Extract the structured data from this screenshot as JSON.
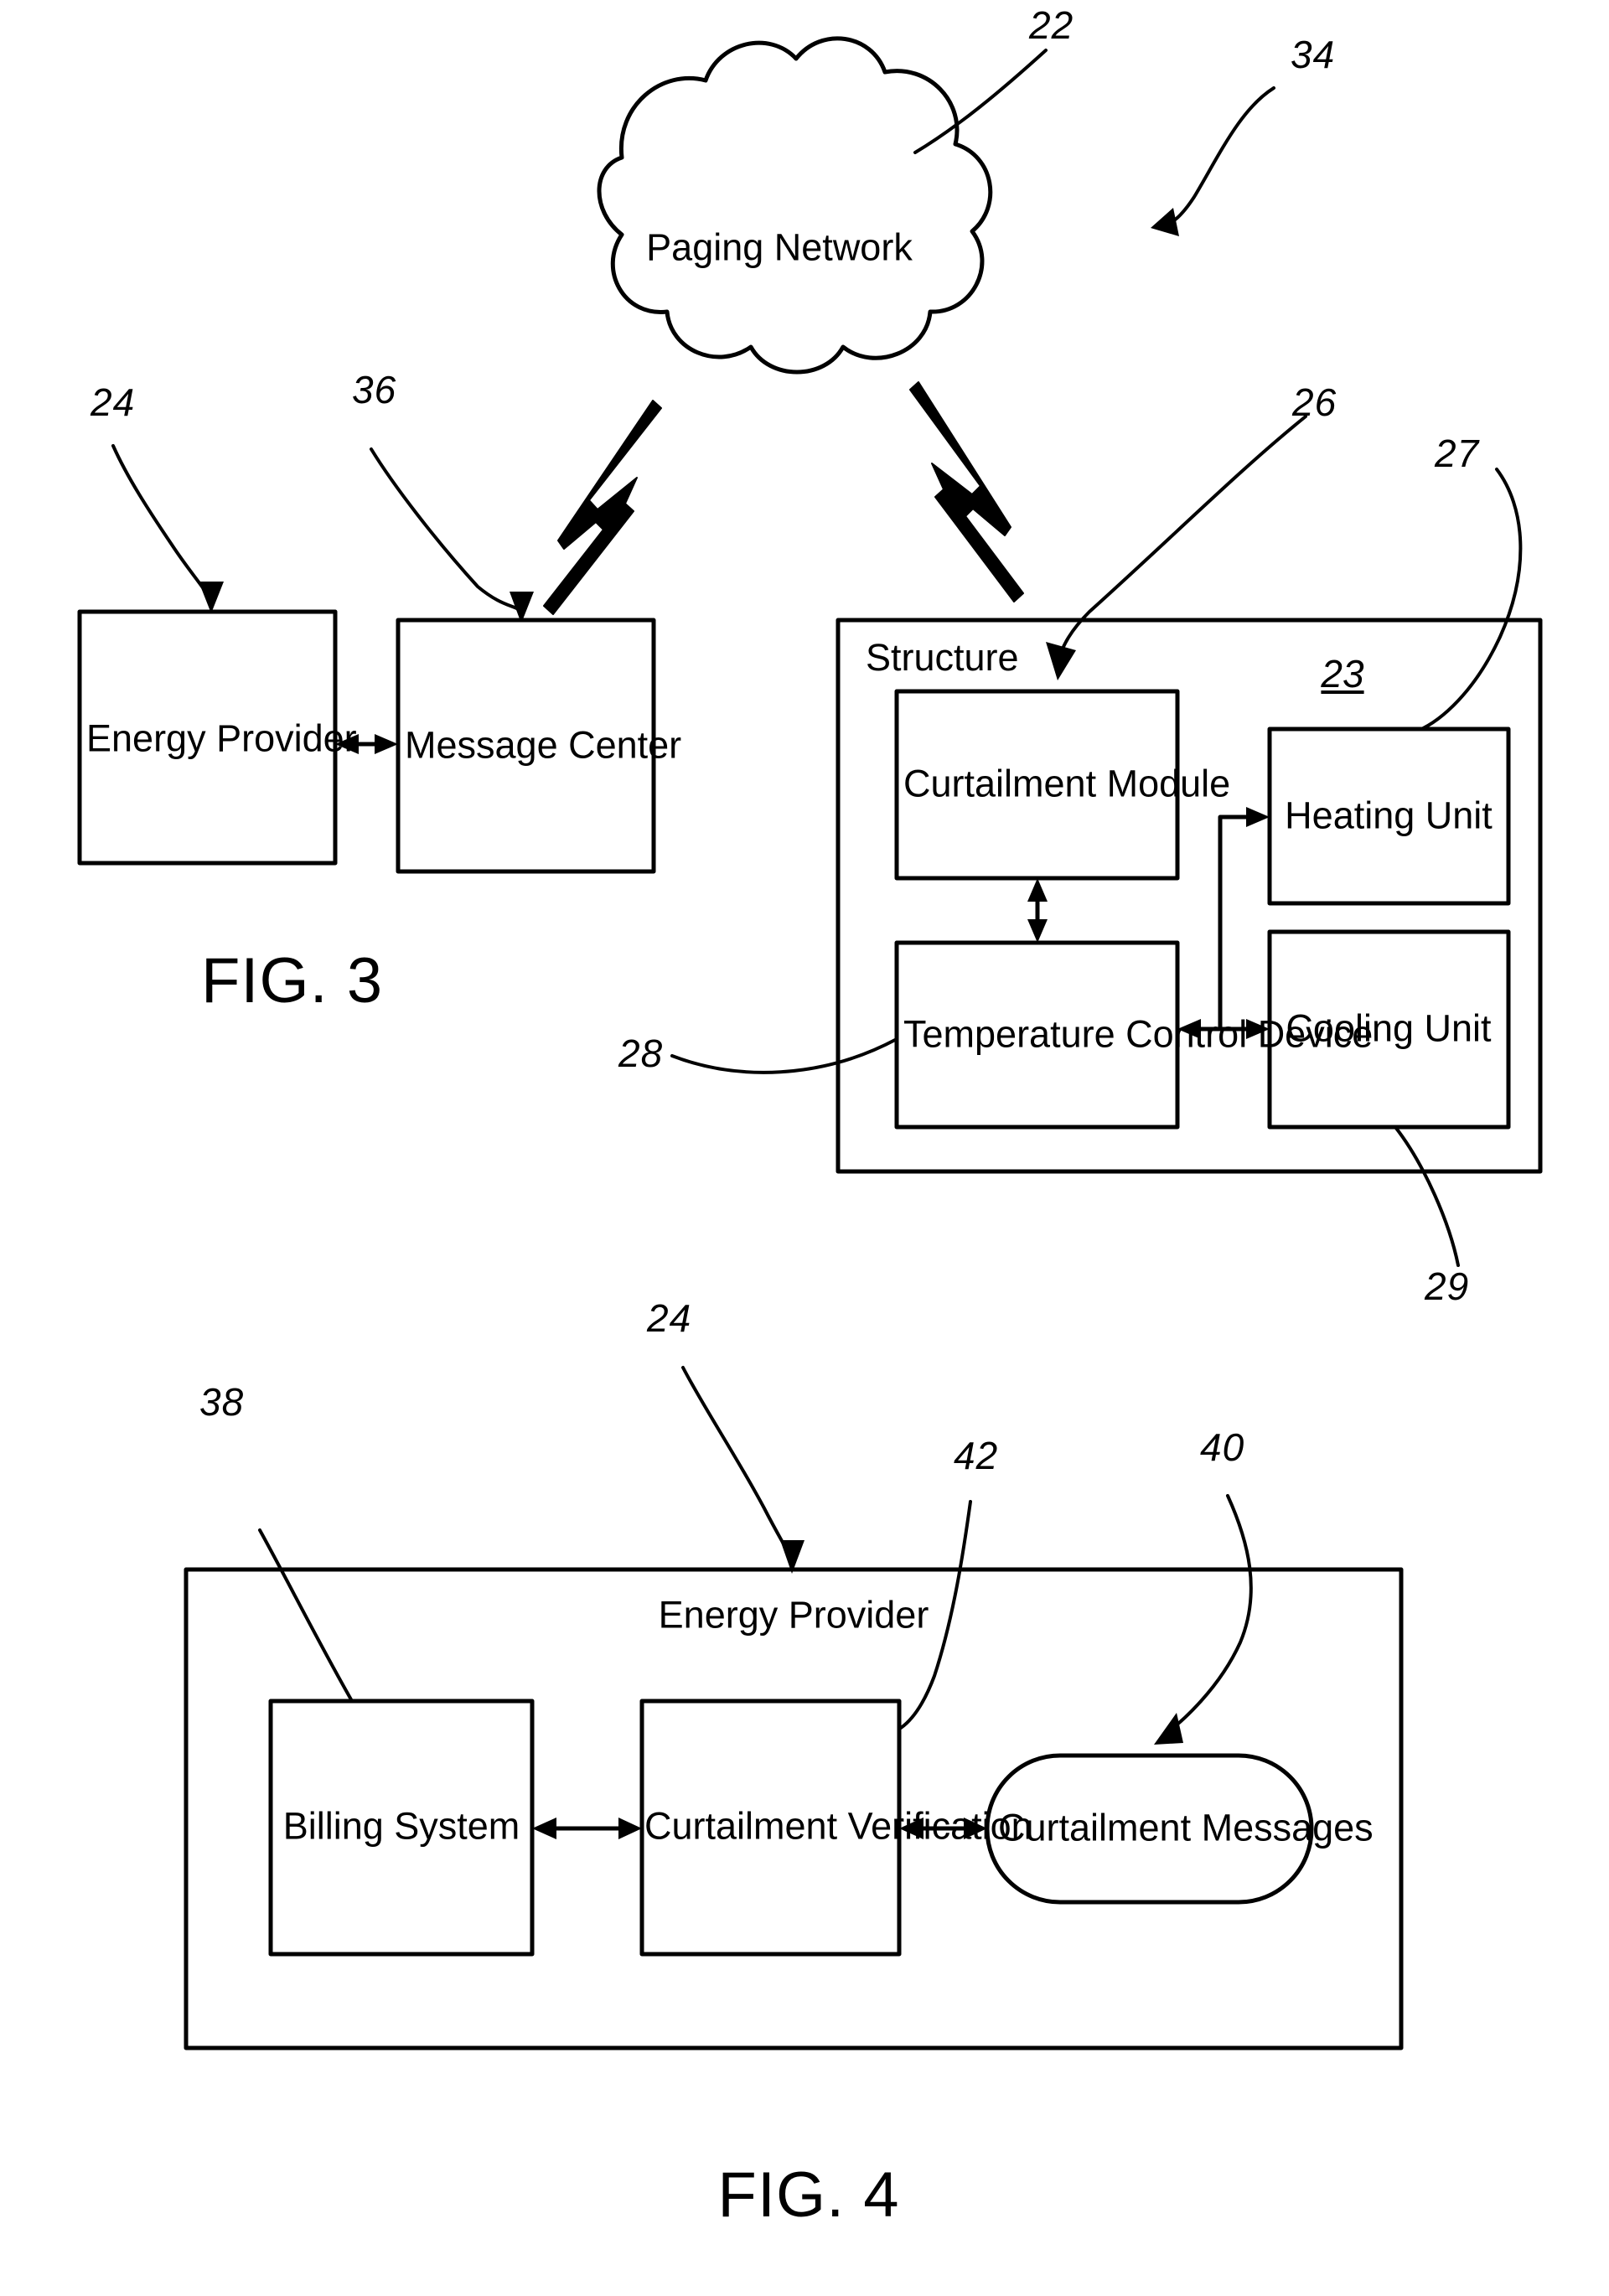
{
  "figures": [
    {
      "caption": "FIG. 3",
      "nodes": {
        "paging_network": "Paging Network",
        "energy_provider": "Energy Provider",
        "message_center": "Message Center",
        "structure": "Structure",
        "curtailment_module": "Curtailment Module",
        "temperature_control_device": "Temperature Control Device",
        "heating_unit": "Heating Unit",
        "cooling_unit": "Cooling Unit"
      },
      "refs": {
        "paging_network": "22",
        "system": "34",
        "energy_provider": "24",
        "message_center": "36",
        "curtailment_module": "26",
        "heating_unit": "27",
        "hvac_group": "23",
        "temperature_control_device": "28",
        "cooling_unit": "29"
      }
    },
    {
      "caption": "FIG. 4",
      "nodes": {
        "energy_provider": "Energy Provider",
        "billing_system": "Billing System",
        "curtailment_verification": "Curtailment Verification",
        "curtailment_messages": "Curtailment Messages"
      },
      "refs": {
        "billing_system": "38",
        "energy_provider": "24",
        "curtailment_verification": "42",
        "curtailment_messages": "40"
      }
    }
  ],
  "colors": {
    "ink": "#000000",
    "paper": "#ffffff"
  }
}
